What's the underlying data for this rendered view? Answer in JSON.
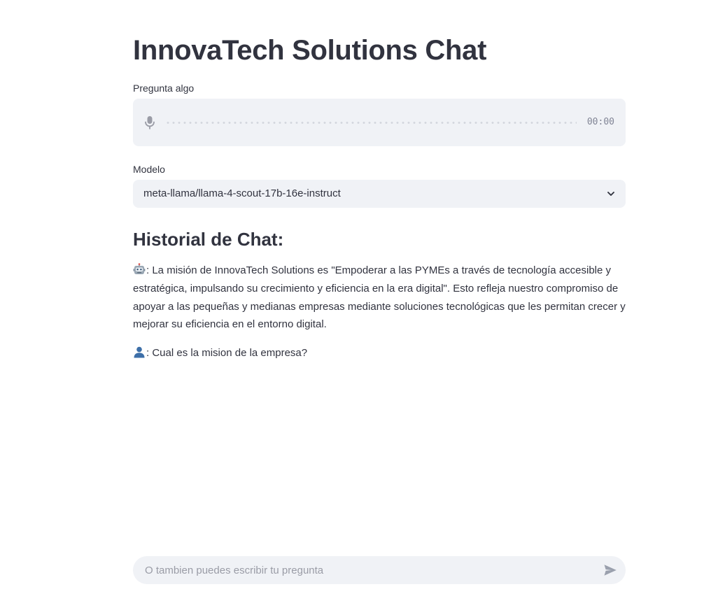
{
  "header": {
    "title": "InnovaTech Solutions Chat"
  },
  "audio_input": {
    "label": "Pregunta algo",
    "timer": "00:00",
    "mic_icon": "microphone-icon"
  },
  "model": {
    "label": "Modelo",
    "selected": "meta-llama/llama-4-scout-17b-16e-instruct",
    "chevron_icon": "chevron-down-icon"
  },
  "history": {
    "heading": "Historial de Chat:",
    "messages": [
      {
        "role": "assistant",
        "icon": "robot-icon",
        "prefix": ": ",
        "text": "La misión de InnovaTech Solutions es \"Empoderar a las PYMEs a través de tecnología accesible y estratégica, impulsando su crecimiento y eficiencia en la era digital\". Esto refleja nuestro compromiso de apoyar a las pequeñas y medianas empresas mediante soluciones tecnológicas que les permitan crecer y mejorar su eficiencia en el entorno digital."
      },
      {
        "role": "user",
        "icon": "user-icon",
        "prefix": ": ",
        "text": "Cual es la mision de la empresa?"
      }
    ]
  },
  "chat_input": {
    "placeholder": "O tambien puedes escribir tu pregunta",
    "value": "",
    "send_icon": "send-icon"
  },
  "colors": {
    "text": "#31333f",
    "input_background": "#f0f2f6",
    "muted": "#9a9ca6"
  }
}
